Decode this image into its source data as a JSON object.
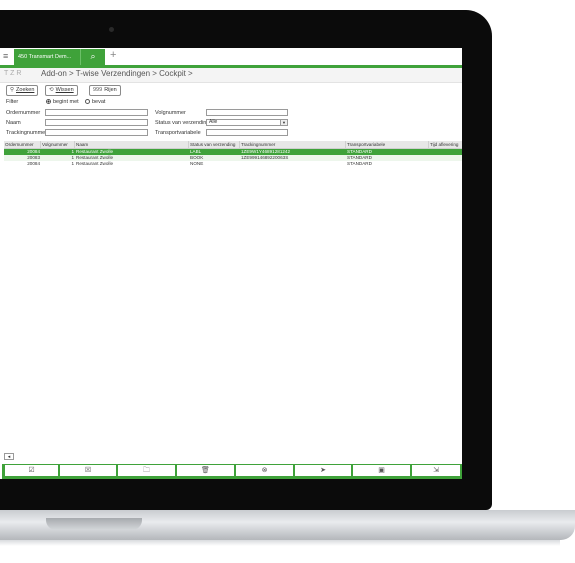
{
  "app": {
    "tab_title": "450 Transmart Dem...",
    "tab_search_icon": "search-icon",
    "tab_add": "+",
    "shortcut_keys": "T  Z  R",
    "breadcrumb": "Add-on > T-wise Verzendingen > Cockpit >"
  },
  "toolbar": {
    "search_label": "Zoeken",
    "clear_label": "Wissen",
    "rows_label": "Rijen",
    "rows_badge": "999"
  },
  "filter": {
    "label": "Filter",
    "option_begins": "begint met",
    "option_contains": "bevat",
    "selected": "begint met"
  },
  "form": {
    "order_label": "Ordernummer",
    "order_value": "",
    "follow_label": "Volgnummer",
    "follow_value": "",
    "name_label": "Naam",
    "name_value": "",
    "status_label": "Status van verzending",
    "status_value": "Alle",
    "tracking_label": "Trackingnummer",
    "tracking_value": "",
    "transport_label": "Transportvariabele",
    "transport_value": ""
  },
  "table": {
    "headers": [
      "Ordernummer",
      "Volgnummer",
      "Naam",
      "Status van verzending",
      "Trackingnummer",
      "Transportvariabele",
      "Tijd aflevering"
    ],
    "rows": [
      {
        "order": "20084",
        "follow": "1",
        "name": "Restaurant Zwolle",
        "status": "LABL",
        "tracking": "1ZE9W1Y46891281242",
        "transport": "STANDARD",
        "time": ""
      },
      {
        "order": "20083",
        "follow": "1",
        "name": "Restaurant Zwolle",
        "status": "BOOK",
        "tracking": "1ZE99914689220063S",
        "transport": "STANDARD",
        "time": ""
      },
      {
        "order": "20084",
        "follow": "1",
        "name": "Restaurant Zwolle",
        "status": "NONE",
        "tracking": "",
        "transport": "STANDARD",
        "time": ""
      }
    ]
  },
  "bottombar": {
    "buttons": [
      "check-icon",
      "close-box-icon",
      "folder-icon",
      "trash-icon",
      "cancel-circle-icon",
      "send-icon",
      "calendar-icon",
      "export-icon"
    ],
    "glyphs": [
      "☑",
      "☒",
      "🗀",
      "🗑",
      "⊗",
      "➤",
      "▣",
      "⇲"
    ]
  }
}
